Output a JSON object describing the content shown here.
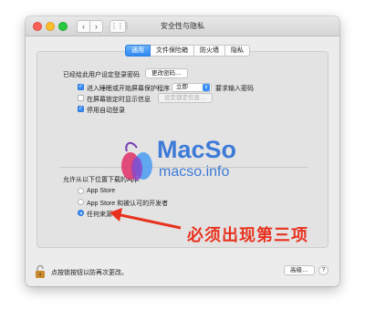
{
  "window": {
    "title": "安全性与隐私"
  },
  "toolbar": {
    "back_label": "‹",
    "forward_label": "›",
    "grid_label": "⋮⋮⋮"
  },
  "tabs": [
    {
      "label": "通用",
      "active": true
    },
    {
      "label": "文件保险箱",
      "active": false
    },
    {
      "label": "防火墙",
      "active": false
    },
    {
      "label": "隐私",
      "active": false
    }
  ],
  "general": {
    "password_set_text": "已经给此用户设定登录密码",
    "change_password_button": "更改密码…",
    "require_password": {
      "label": "进入睡眠或开始屏幕保护程序",
      "checked": true,
      "select_value": "立即",
      "suffix": "要求输入密码"
    },
    "show_message": {
      "label": "在屏幕锁定时显示信息",
      "checked": false,
      "button": "设定锁定信息…"
    },
    "disable_auto_login": {
      "label": "停用自动登录",
      "checked": true
    }
  },
  "downloads": {
    "heading": "允许从以下位置下载的App:",
    "options": [
      {
        "label": "App Store",
        "selected": false
      },
      {
        "label": "App Store 和被认可的开发者",
        "selected": false
      },
      {
        "label": "任何来源",
        "selected": true
      }
    ]
  },
  "footer": {
    "lock_text": "点按锁按钮以防再次更改。",
    "advanced_button": "高级…",
    "help_label": "?"
  },
  "watermark": {
    "name": "MacSo",
    "url": "macso.info"
  },
  "annotation": {
    "text": "必须出现第三项",
    "color": "#e8321f"
  },
  "colors": {
    "accent": "#3a8ef6",
    "watermark": "#2d6fd6"
  }
}
